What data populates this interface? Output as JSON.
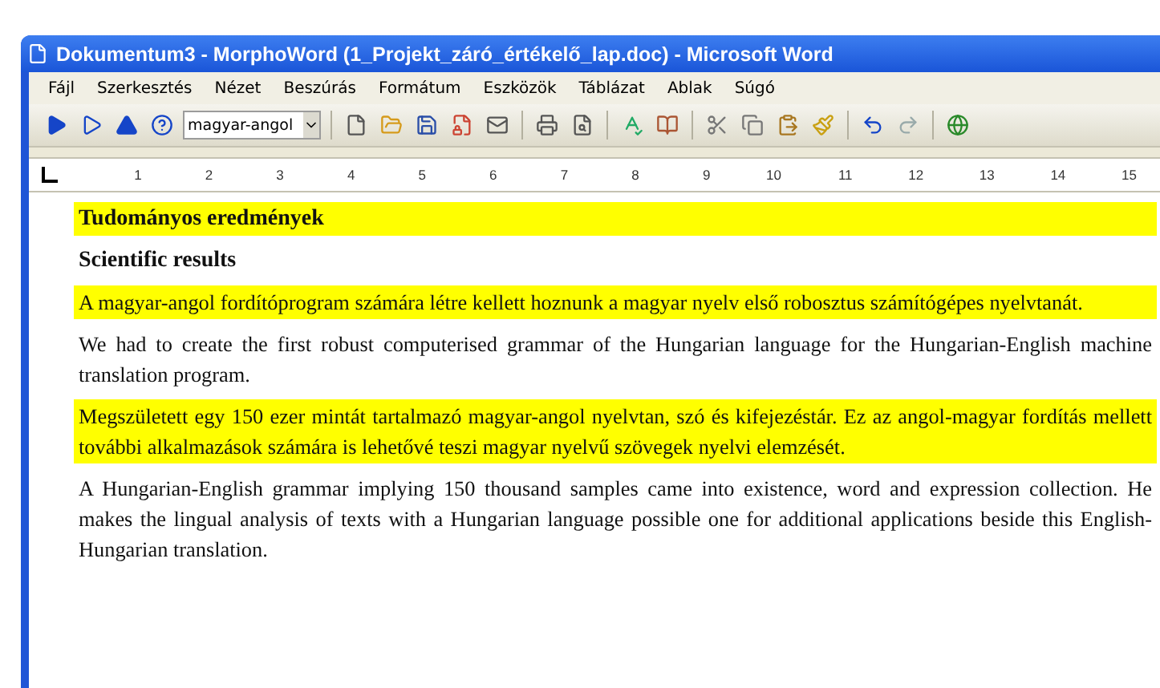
{
  "window": {
    "title": "Dokumentum3 - MorphoWord (1_Projekt_záró_értékelő_lap.doc) - Microsoft Word"
  },
  "menu": [
    "Fájl",
    "Szerkesztés",
    "Nézet",
    "Beszúrás",
    "Formátum",
    "Eszközök",
    "Táblázat",
    "Ablak",
    "Súgó"
  ],
  "toolbar": {
    "language_select": {
      "value": "magyar-angol"
    },
    "buttons": [
      {
        "kind": "play"
      },
      {
        "kind": "play-outline"
      },
      {
        "kind": "eject"
      },
      {
        "kind": "help"
      },
      {
        "kind": "combo"
      },
      {
        "kind": "sep"
      },
      {
        "kind": "new"
      },
      {
        "kind": "open"
      },
      {
        "kind": "save"
      },
      {
        "kind": "permission"
      },
      {
        "kind": "mail"
      },
      {
        "kind": "sep"
      },
      {
        "kind": "print"
      },
      {
        "kind": "preview"
      },
      {
        "kind": "sep"
      },
      {
        "kind": "spell"
      },
      {
        "kind": "research"
      },
      {
        "kind": "sep"
      },
      {
        "kind": "cut"
      },
      {
        "kind": "copy"
      },
      {
        "kind": "paste"
      },
      {
        "kind": "brush"
      },
      {
        "kind": "sep"
      },
      {
        "kind": "undo"
      },
      {
        "kind": "redo"
      },
      {
        "kind": "sep"
      },
      {
        "kind": "link"
      }
    ]
  },
  "ruler": {
    "marks": [
      "1",
      "2",
      "3",
      "4",
      "5",
      "6",
      "7",
      "8",
      "9",
      "10",
      "11",
      "12",
      "13",
      "14",
      "15"
    ]
  },
  "document": {
    "paragraphs": [
      {
        "kind": "heading",
        "text": "Tudományos eredmények",
        "highlighted": true
      },
      {
        "kind": "heading",
        "text": "Scientific results",
        "highlighted": false
      },
      {
        "kind": "body",
        "text": "A magyar-angol fordítóprogram számára létre kellett hoznunk a magyar nyelv első robosztus számítógépes nyelvtanát.",
        "highlighted": true
      },
      {
        "kind": "body",
        "text": "We had to create the first robust computerised grammar of the Hungarian language for the Hungarian-English machine translation program.",
        "highlighted": false
      },
      {
        "kind": "body",
        "text": "Megszületett egy 150 ezer mintát tartalmazó magyar-angol nyelvtan, szó és kifejezéstár. Ez az angol-magyar fordítás mellett további alkalmazások számára is lehetővé teszi magyar nyelvű szövegek nyelvi elemzését.",
        "highlighted": true
      },
      {
        "kind": "body",
        "text": "A Hungarian-English grammar implying 150 thousand samples came into existence, word and expression collection. He makes the lingual analysis of texts with a Hungarian language possible one for additional applications beside this English-Hungarian translation.",
        "highlighted": false
      }
    ]
  }
}
